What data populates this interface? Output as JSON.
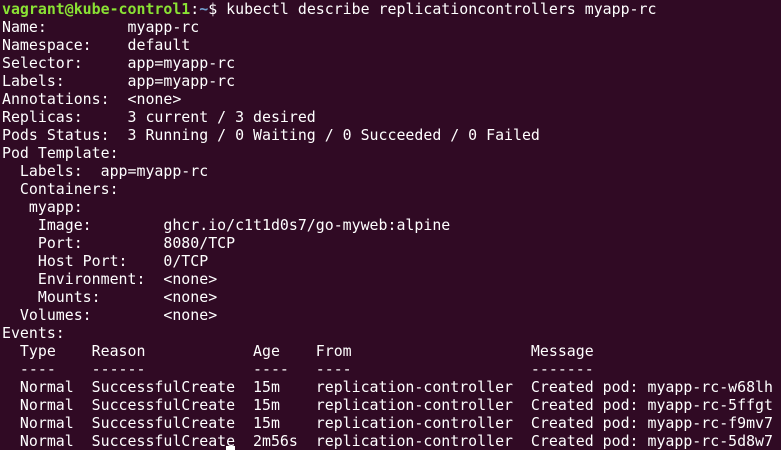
{
  "prompt": {
    "user_host": "vagrant@kube-control1",
    "separator": ":",
    "path": "~",
    "symbol": "$ ",
    "command": "kubectl describe replicationcontrollers myapp-rc"
  },
  "output": [
    "Name:         myapp-rc",
    "Namespace:    default",
    "Selector:     app=myapp-rc",
    "Labels:       app=myapp-rc",
    "Annotations:  <none>",
    "Replicas:     3 current / 3 desired",
    "Pods Status:  3 Running / 0 Waiting / 0 Succeeded / 0 Failed",
    "Pod Template:",
    "  Labels:  app=myapp-rc",
    "  Containers:",
    "   myapp:",
    "    Image:        ghcr.io/c1t1d0s7/go-myweb:alpine",
    "    Port:         8080/TCP",
    "    Host Port:    0/TCP",
    "    Environment:  <none>",
    "    Mounts:       <none>",
    "  Volumes:        <none>",
    "Events:",
    "  Type    Reason            Age    From                    Message",
    "  ----    ------            ----   ----                    -------",
    "  Normal  SuccessfulCreate  15m    replication-controller  Created pod: myapp-rc-w68lh",
    "  Normal  SuccessfulCreate  15m    replication-controller  Created pod: myapp-rc-5ffgt",
    "  Normal  SuccessfulCreate  15m    replication-controller  Created pod: myapp-rc-f9mv7",
    "  Normal  SuccessfulCreate  2m56s  replication-controller  Created pod: myapp-rc-5d8w7"
  ],
  "colors": {
    "background": "#300a24",
    "text": "#ffffff",
    "user_host": "#8ae234",
    "path": "#729fcf"
  }
}
